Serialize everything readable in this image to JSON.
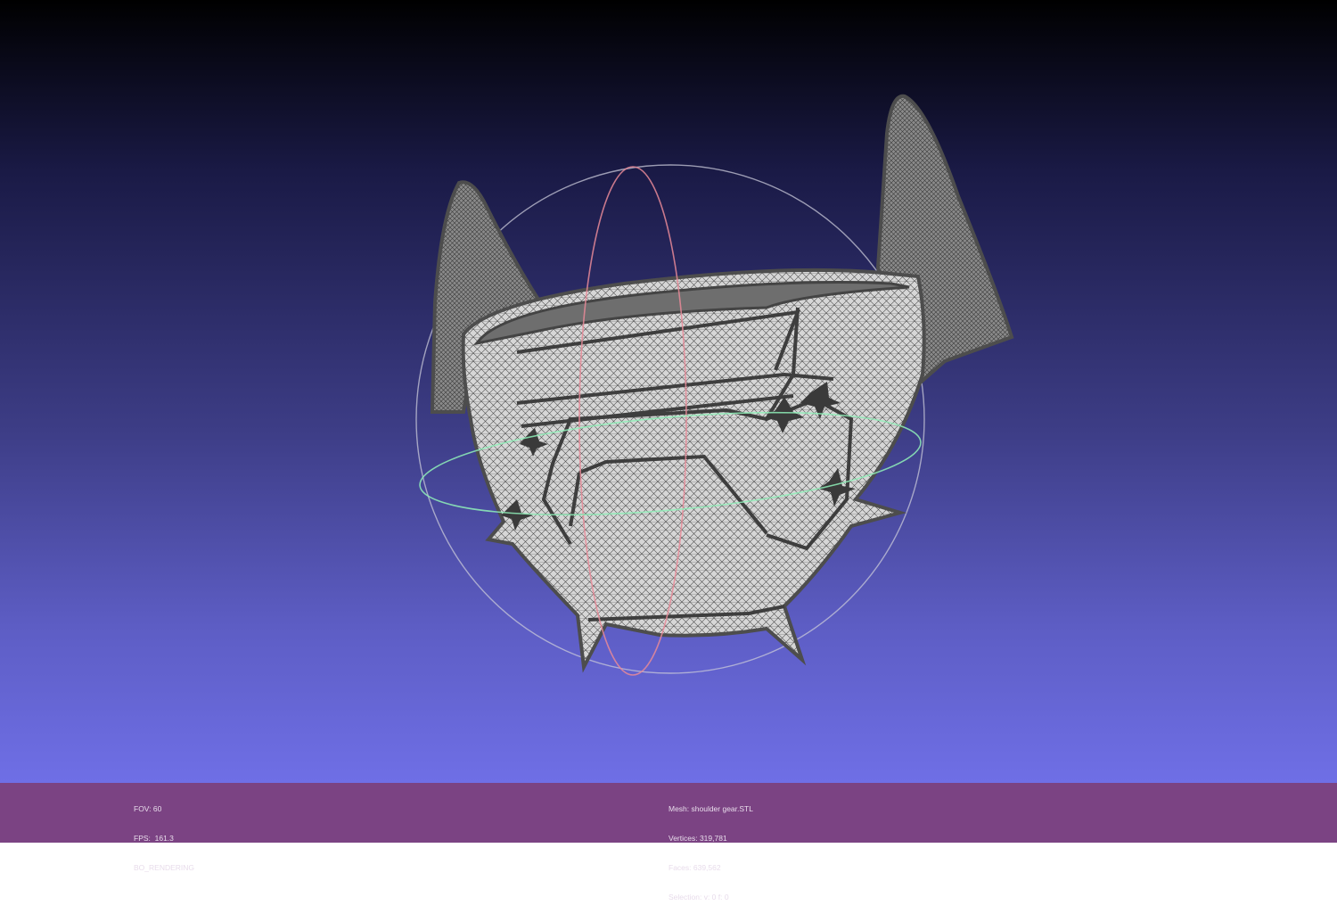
{
  "colors": {
    "background_top": "#000000",
    "background_bottom": "#6f6fe6",
    "status_bar": "#7b4383",
    "mesh_fill": "#cfcfcf",
    "mesh_edge": "#555555",
    "trackball_x": "#e88a98",
    "trackball_y": "#8ff0b8",
    "trackball_z": "#c8c8d8"
  },
  "viewport": {
    "model_icon": "shoulder-armor-mesh-icon",
    "trackball_icon": "trackball-icon"
  },
  "status": {
    "fov": "FOV: 60",
    "fps": "FPS:  161.3",
    "render_mode": "BO_RENDERING",
    "mesh": "Mesh: shoulder gear.STL",
    "vertices": "Vertices: 319,781",
    "faces": "Faces: 639,562",
    "selection": "Selection: v: 0 f: 0"
  }
}
